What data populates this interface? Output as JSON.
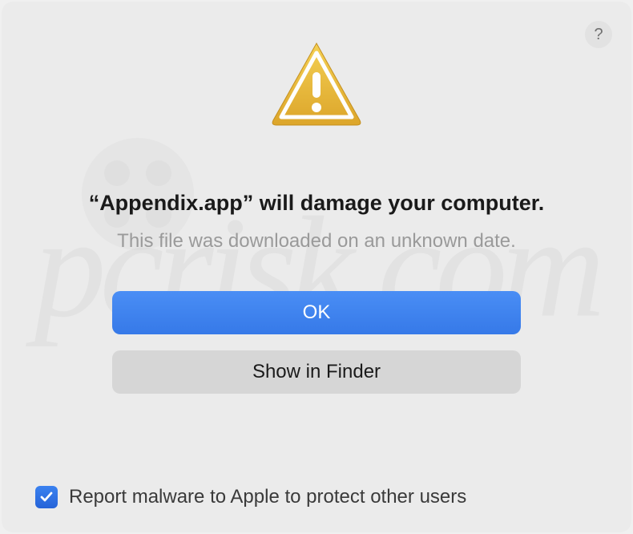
{
  "dialog": {
    "help_label": "?",
    "title": "“Appendix.app” will damage your computer.",
    "subtitle": "This file was downloaded on an unknown date.",
    "ok_label": "OK",
    "show_in_finder_label": "Show in Finder",
    "checkbox_label": "Report malware to Apple to protect other users",
    "checkbox_checked": true
  },
  "colors": {
    "primary_button": "#3679e8",
    "secondary_button": "#d6d6d6",
    "checkbox": "#2563d8"
  }
}
